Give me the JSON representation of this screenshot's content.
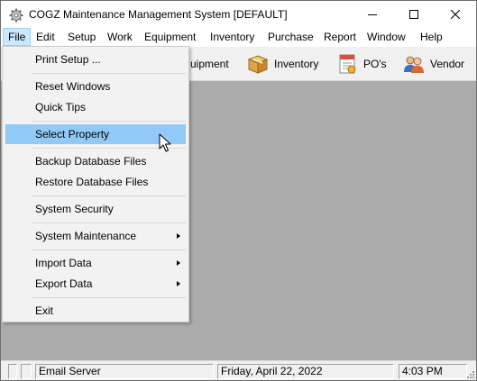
{
  "window": {
    "title": "COGZ Maintenance Management System [DEFAULT]"
  },
  "menubar": {
    "items": [
      "File",
      "Edit",
      "Setup",
      "Work",
      "Equipment",
      "Inventory",
      "Purchase",
      "Report",
      "Window",
      "Help"
    ],
    "active": "File"
  },
  "toolbar": {
    "equipment_label": "uipment",
    "inventory_label": "Inventory",
    "pos_label": "PO's",
    "vendor_label": "Vendor"
  },
  "file_menu": {
    "print_setup": "Print Setup ...",
    "reset_windows": "Reset Windows",
    "quick_tips": "Quick Tips",
    "select_property": "Select Property",
    "backup_database": "Backup Database Files",
    "restore_database": "Restore Database Files",
    "system_security": "System Security",
    "system_maintenance": "System Maintenance",
    "import_data": "Import Data",
    "export_data": "Export Data",
    "exit": "Exit",
    "highlighted": "Select Property"
  },
  "statusbar": {
    "email": "Email Server",
    "date": "Friday, April 22, 2022",
    "time": "4:03 PM"
  },
  "colors": {
    "client_bg": "#ababab",
    "menu_highlight": "#91c9f7",
    "menubar_active": "#cce8ff"
  }
}
